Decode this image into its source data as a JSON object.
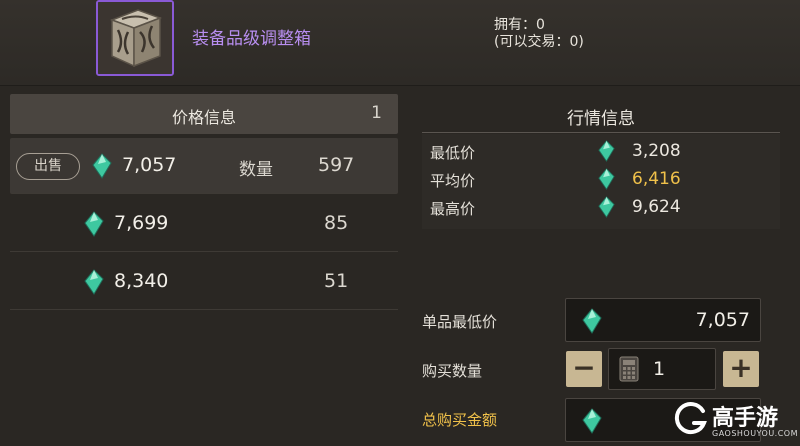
{
  "item": {
    "name": "装备品级调整箱",
    "icon": "cube-box-icon"
  },
  "ownership": {
    "owned": "拥有：0",
    "tradable": "(可以交易：0)"
  },
  "price_panel": {
    "title": "价格信息",
    "page": "1",
    "sell_label": "出售",
    "qty_label": "数量",
    "rows": [
      {
        "price": "7,057",
        "qty": "597",
        "selected": true
      },
      {
        "price": "7,699",
        "qty": "85"
      },
      {
        "price": "8,340",
        "qty": "51"
      }
    ]
  },
  "market_panel": {
    "title": "行情信息",
    "min_label": "最低价",
    "min_value": "3,208",
    "avg_label": "平均价",
    "avg_value": "6,416",
    "max_label": "最高价",
    "max_value": "9,624"
  },
  "purchase": {
    "unit_min_label": "单品最低价",
    "unit_min_value": "7,057",
    "qty_label": "购买数量",
    "qty_value": "1",
    "minus": "−",
    "plus": "+",
    "total_label": "总购买金额"
  },
  "watermark": {
    "text": "高手游",
    "sub": "GAOSHOUYOU.COM"
  },
  "colors": {
    "accent_purple": "#b88ef0",
    "gold": "#f0c14a",
    "gem": "#3ec8a0"
  }
}
